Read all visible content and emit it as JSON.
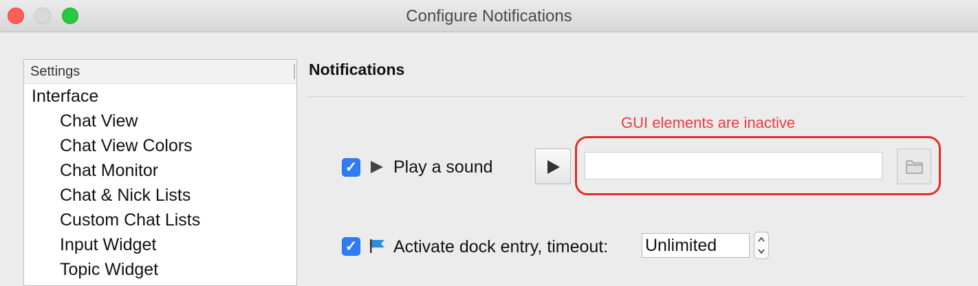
{
  "window": {
    "title": "Configure Notifications"
  },
  "sidebar": {
    "header": "Settings",
    "items": [
      {
        "label": "Interface",
        "level": 0
      },
      {
        "label": "Chat View",
        "level": 1
      },
      {
        "label": "Chat View Colors",
        "level": 1
      },
      {
        "label": "Chat Monitor",
        "level": 1
      },
      {
        "label": "Chat & Nick Lists",
        "level": 1
      },
      {
        "label": "Custom Chat Lists",
        "level": 1
      },
      {
        "label": "Input Widget",
        "level": 1
      },
      {
        "label": "Topic Widget",
        "level": 1
      }
    ]
  },
  "main": {
    "section_title": "Notifications",
    "annotation": "GUI elements are inactive",
    "annotation_color": "#ea3b3b",
    "play_sound": {
      "checked": true,
      "icon": "play-icon",
      "label": "Play a sound",
      "file_value": "",
      "play_button_icon": "play-icon",
      "browse_button_icon": "folder-icon"
    },
    "dock_entry": {
      "checked": true,
      "icon": "flag-icon",
      "label": "Activate dock entry, timeout:",
      "timeout_value": "Unlimited"
    }
  },
  "colors": {
    "accent": "#2f7cf6",
    "highlight": "#e52a2a"
  }
}
